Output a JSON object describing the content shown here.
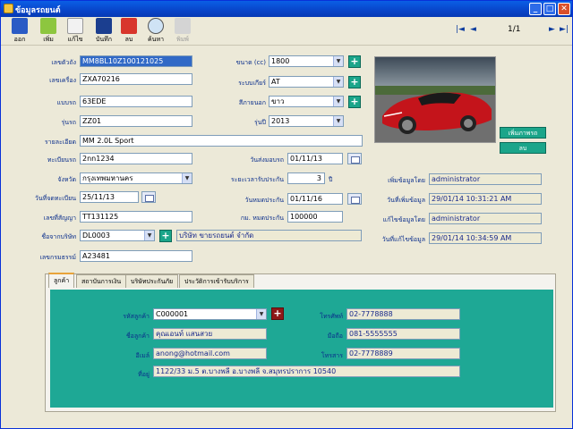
{
  "window": {
    "title": "ข้อมูลรถยนต์"
  },
  "toolbar": {
    "exit": "ออก",
    "add": "เพิ่ม",
    "edit": "แก้ไข",
    "save": "บันทึก",
    "delete": "ลบ",
    "search": "ค้นหา",
    "print": "พิมพ์",
    "page": "1/1"
  },
  "form": {
    "chassis_label": "เลขตัวถัง",
    "chassis": "MM8BL10Z100121025",
    "engine_label": "เลขเครื่อง",
    "engine": "ZXA70216",
    "model_label": "แบบรถ",
    "model": "63EDE",
    "series_label": "รุ่นรถ",
    "series": "ZZ01",
    "detail_label": "รายละเอียด",
    "detail": "MM 2.0L Sport",
    "plate_label": "ทะเบียนรถ",
    "plate": "2nn1234",
    "province_label": "จังหวัด",
    "province": "กรุงเทพมหานคร",
    "regdate_label": "วันที่จดทะเบียน",
    "regdate": "25/11/13",
    "contract_label": "เลขที่สัญญา",
    "contract": "TT131125",
    "dealer_label": "ชื่อจากบริษัท",
    "dealer": "DL0003",
    "dealer_name": "บริษัท ขายรถยนต์ จำกัด",
    "policy_label": "เลขกรมธรรม์",
    "policy": "A23481",
    "size_label": "ขนาด (cc)",
    "size": "1800",
    "gear_label": "ระบบเกียร์",
    "gear": "AT",
    "color_label": "สีภายนอก",
    "color": "ขาว",
    "year_label": "รุ่นปี",
    "year": "2013",
    "deliver_label": "วันส่งมอบรถ",
    "deliver": "01/11/13",
    "warranty_label": "ระยะเวลารับประกัน",
    "warranty": "3",
    "warranty_unit": "ปี",
    "expire_label": "วันหมดประกัน",
    "expire": "01/11/16",
    "km_label": "กม. หมดประกัน",
    "km": "100000",
    "add_pic": "เพิ่มภาพรถ",
    "del_pic": "ลบ",
    "addby_label": "เพิ่มข้อมูลโดย",
    "addby": "administrator",
    "adddate_label": "วันที่เพิ่มข้อมูล",
    "adddate": "29/01/14 10:31:21 AM",
    "editby_label": "แก้ไขข้อมูลโดย",
    "editby": "administrator",
    "editdate_label": "วันที่แก้ไขข้อมูล",
    "editdate": "29/01/14 10:34:59 AM"
  },
  "tabs": [
    "ลูกค้า",
    "สถาบันการเงิน",
    "บริษัทประกันภัย",
    "ประวัติการเข้ารับบริการ"
  ],
  "customer": {
    "code_label": "รหัสลูกค้า",
    "code": "C000001",
    "name_label": "ชื่อลูกค้า",
    "name": "คุณเอนท์ แสนสวย",
    "email_label": "อีเมล์",
    "email": "anong@hotmail.com",
    "addr_label": "ที่อยู่",
    "addr": "1122/33 ม.5  ต.บางพลี  อ.บางพลี  จ.สมุทรปราการ  10540",
    "phone_label": "โทรศัพท์",
    "phone": "02-7778888",
    "mobile_label": "มือถือ",
    "mobile": "081-5555555",
    "fax_label": "โทรสาร",
    "fax": "02-7778889"
  }
}
